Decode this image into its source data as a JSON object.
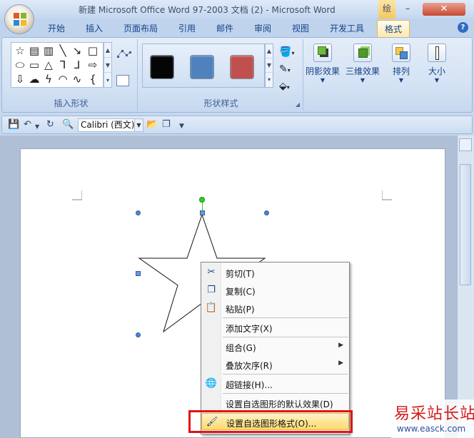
{
  "window": {
    "title": "新建 Microsoft Office Word 97-2003 文档 (2) - Microsoft Word",
    "contextual_tab_header": "绘",
    "minimize": "–",
    "close": "✕"
  },
  "ribbon_tabs": [
    {
      "label": "开始"
    },
    {
      "label": "插入"
    },
    {
      "label": "页面布局"
    },
    {
      "label": "引用"
    },
    {
      "label": "邮件"
    },
    {
      "label": "审阅"
    },
    {
      "label": "视图"
    },
    {
      "label": "开发工具"
    },
    {
      "label": "格式",
      "active": true
    }
  ],
  "help_icon": "?",
  "groups": {
    "insert_shapes": {
      "label": "插入形状"
    },
    "shape_styles": {
      "label": "形状样式",
      "swatches": [
        "#050505",
        "#4f81bd",
        "#c0504d"
      ]
    },
    "shadow": {
      "label": "阴影效果"
    },
    "threed": {
      "label": "三维效果"
    },
    "arrange": {
      "label": "排列"
    },
    "size": {
      "label": "大小"
    }
  },
  "quick_access": {
    "font_name": "Calibri (西文)"
  },
  "context_menu": {
    "items": [
      {
        "label": "剪切(T)",
        "icon": "scissors-icon"
      },
      {
        "label": "复制(C)",
        "icon": "copy-icon"
      },
      {
        "label": "粘贴(P)",
        "icon": "paste-icon"
      },
      {
        "label": "添加文字(X)"
      },
      {
        "label": "组合(G)",
        "submenu": true
      },
      {
        "label": "叠放次序(R)",
        "submenu": true
      },
      {
        "label": "超链接(H)...",
        "icon": "hyperlink-icon"
      },
      {
        "label": "设置自选图形的默认效果(D)"
      },
      {
        "label": "设置自选图形格式(O)...",
        "icon": "format-shape-icon",
        "highlighted": true
      }
    ]
  },
  "watermark": {
    "title": "易采站长站",
    "url": "www.easck.com"
  },
  "colors": {
    "accent_highlight": "#fbd96e",
    "annotation_box": "#e01414",
    "rotation_handle": "#2bd02b",
    "selection_handle": "#4f86cc"
  }
}
